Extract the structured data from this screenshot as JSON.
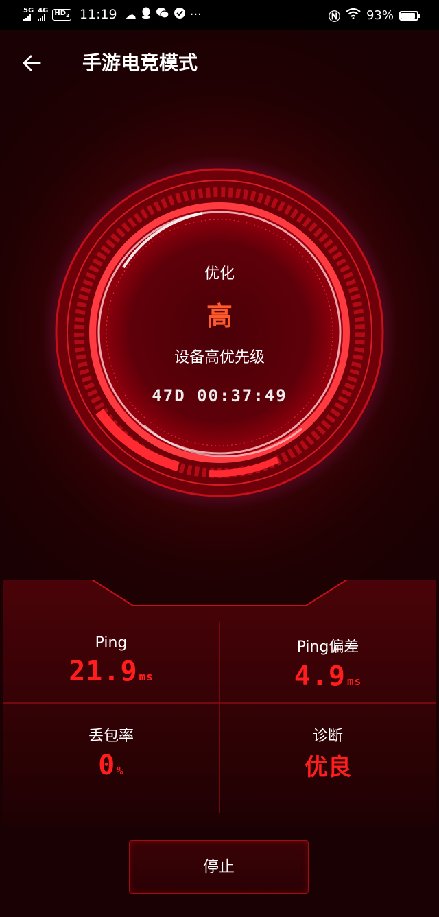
{
  "status_bar": {
    "net1": "5G",
    "net2": "4G",
    "hd": "HD",
    "hd_sub": "2",
    "time": "11:19",
    "more": "···",
    "battery_percent": "93%",
    "battery_level": 0.93
  },
  "header": {
    "back_icon": "arrow-left-icon",
    "title": "手游电竞模式"
  },
  "gauge": {
    "label": "优化",
    "level": "高",
    "priority": "设备高优先级",
    "timer": "47D 00:37:49"
  },
  "stats": {
    "ping": {
      "label": "Ping",
      "value": "21.9",
      "unit": "ms"
    },
    "ping_dev": {
      "label": "Ping偏差",
      "value": "4.9",
      "unit": "ms"
    },
    "loss": {
      "label": "丢包率",
      "value": "0",
      "unit": "%"
    },
    "diag": {
      "label": "诊断",
      "value": "优良"
    }
  },
  "stop_button": {
    "label": "停止"
  },
  "colors": {
    "accent_red": "#ff1d1d",
    "level_orange": "#ff5a2c",
    "background": "#2a0104"
  }
}
